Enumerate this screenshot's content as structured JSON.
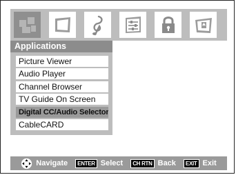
{
  "menu_bar": {
    "icons": [
      {
        "name": "applications-icon",
        "active": true
      },
      {
        "name": "picture-icon",
        "active": false
      },
      {
        "name": "sound-icon",
        "active": false
      },
      {
        "name": "setup-icon",
        "active": false
      },
      {
        "name": "lock-icon",
        "active": false
      },
      {
        "name": "preferences-icon",
        "active": false
      }
    ]
  },
  "panel": {
    "title": "Applications",
    "items": [
      {
        "label": "Picture Viewer"
      },
      {
        "label": "Audio Player"
      },
      {
        "label": "Channel Browser"
      },
      {
        "label": "TV Guide On Screen"
      },
      {
        "label": "Digital CC/Audio Selector",
        "selected": true
      },
      {
        "label": "CableCARD"
      }
    ]
  },
  "footer": {
    "navigate_label": "Navigate",
    "enter_key": "ENTER",
    "select_label": "Select",
    "back_key": "CH RTN",
    "back_label": "Back",
    "exit_key": "EXIT",
    "exit_label": "Exit"
  },
  "colors": {
    "bar_gray": "#bdbdbd",
    "active_gray": "#8f8f8f",
    "title_gray": "#8c8c8c",
    "selected_gray": "#9a9a9a"
  }
}
